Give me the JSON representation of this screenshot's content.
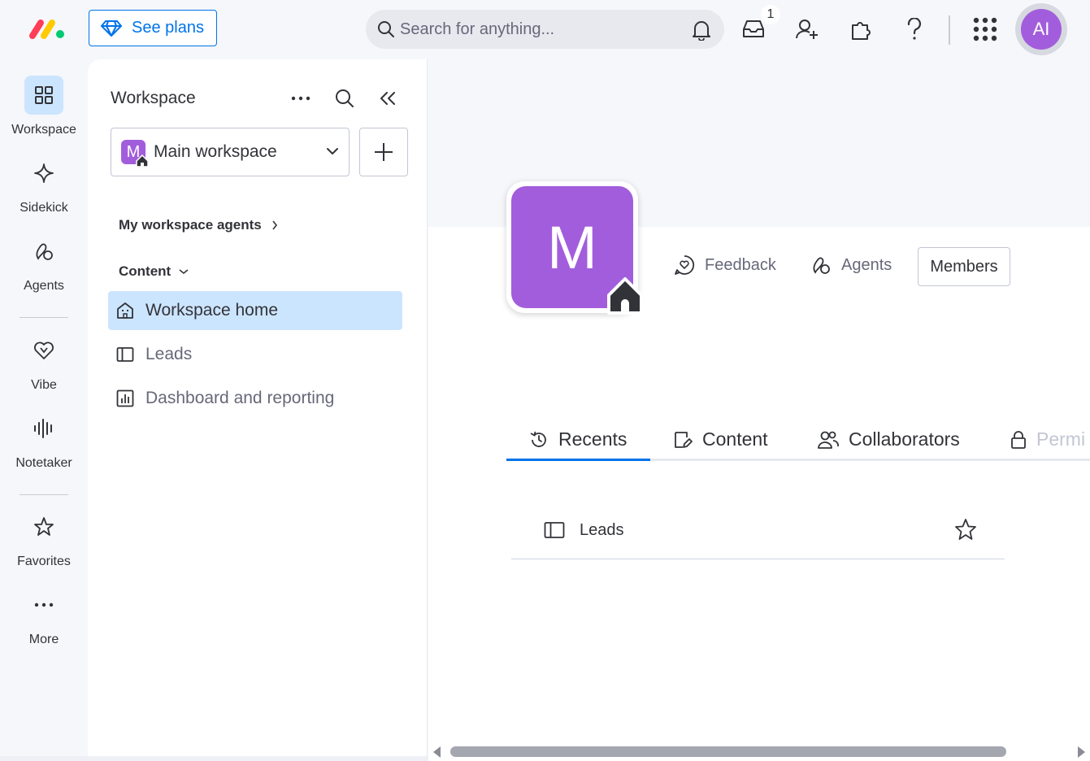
{
  "topbar": {
    "see_plans_label": "See plans",
    "search_placeholder": "Search for anything...",
    "inbox_badge": "1",
    "avatar_initials": "AI"
  },
  "rail": {
    "items": [
      {
        "label": "Workspace",
        "icon": "workspace-grid-icon",
        "active": true
      },
      {
        "label": "Sidekick",
        "icon": "sparkle-icon"
      },
      {
        "label": "Agents",
        "icon": "agents-icon"
      },
      {
        "label": "Vibe",
        "icon": "heart-icon"
      },
      {
        "label": "Notetaker",
        "icon": "waveform-icon"
      },
      {
        "label": "Favorites",
        "icon": "star-icon"
      },
      {
        "label": "More",
        "icon": "more-dots-icon"
      }
    ]
  },
  "panel": {
    "title": "Workspace",
    "workspace_badge": "M",
    "workspace_name": "Main workspace",
    "agents_link": "My workspace agents",
    "content_section": "Content",
    "nav": [
      {
        "label": "Workspace home",
        "icon": "building-icon",
        "active": true
      },
      {
        "label": "Leads",
        "icon": "board-icon"
      },
      {
        "label": "Dashboard and reporting",
        "icon": "dashboard-icon"
      }
    ]
  },
  "main": {
    "workspace_letter": "M",
    "actions": {
      "feedback": "Feedback",
      "agents": "Agents",
      "members": "Members"
    },
    "tabs": [
      {
        "label": "Recents",
        "icon": "history-icon",
        "active": true
      },
      {
        "label": "Content",
        "icon": "content-icon"
      },
      {
        "label": "Collaborators",
        "icon": "people-icon"
      },
      {
        "label": "Permi",
        "icon": "lock-icon",
        "truncated": true
      }
    ],
    "recents": [
      {
        "label": "Leads",
        "icon": "board-icon",
        "starred": false
      }
    ]
  },
  "colors": {
    "primary": "#0073ea",
    "workspace_purple": "#a25ddc",
    "active_bg": "#cce5ff",
    "surface": "#f6f7fb"
  }
}
